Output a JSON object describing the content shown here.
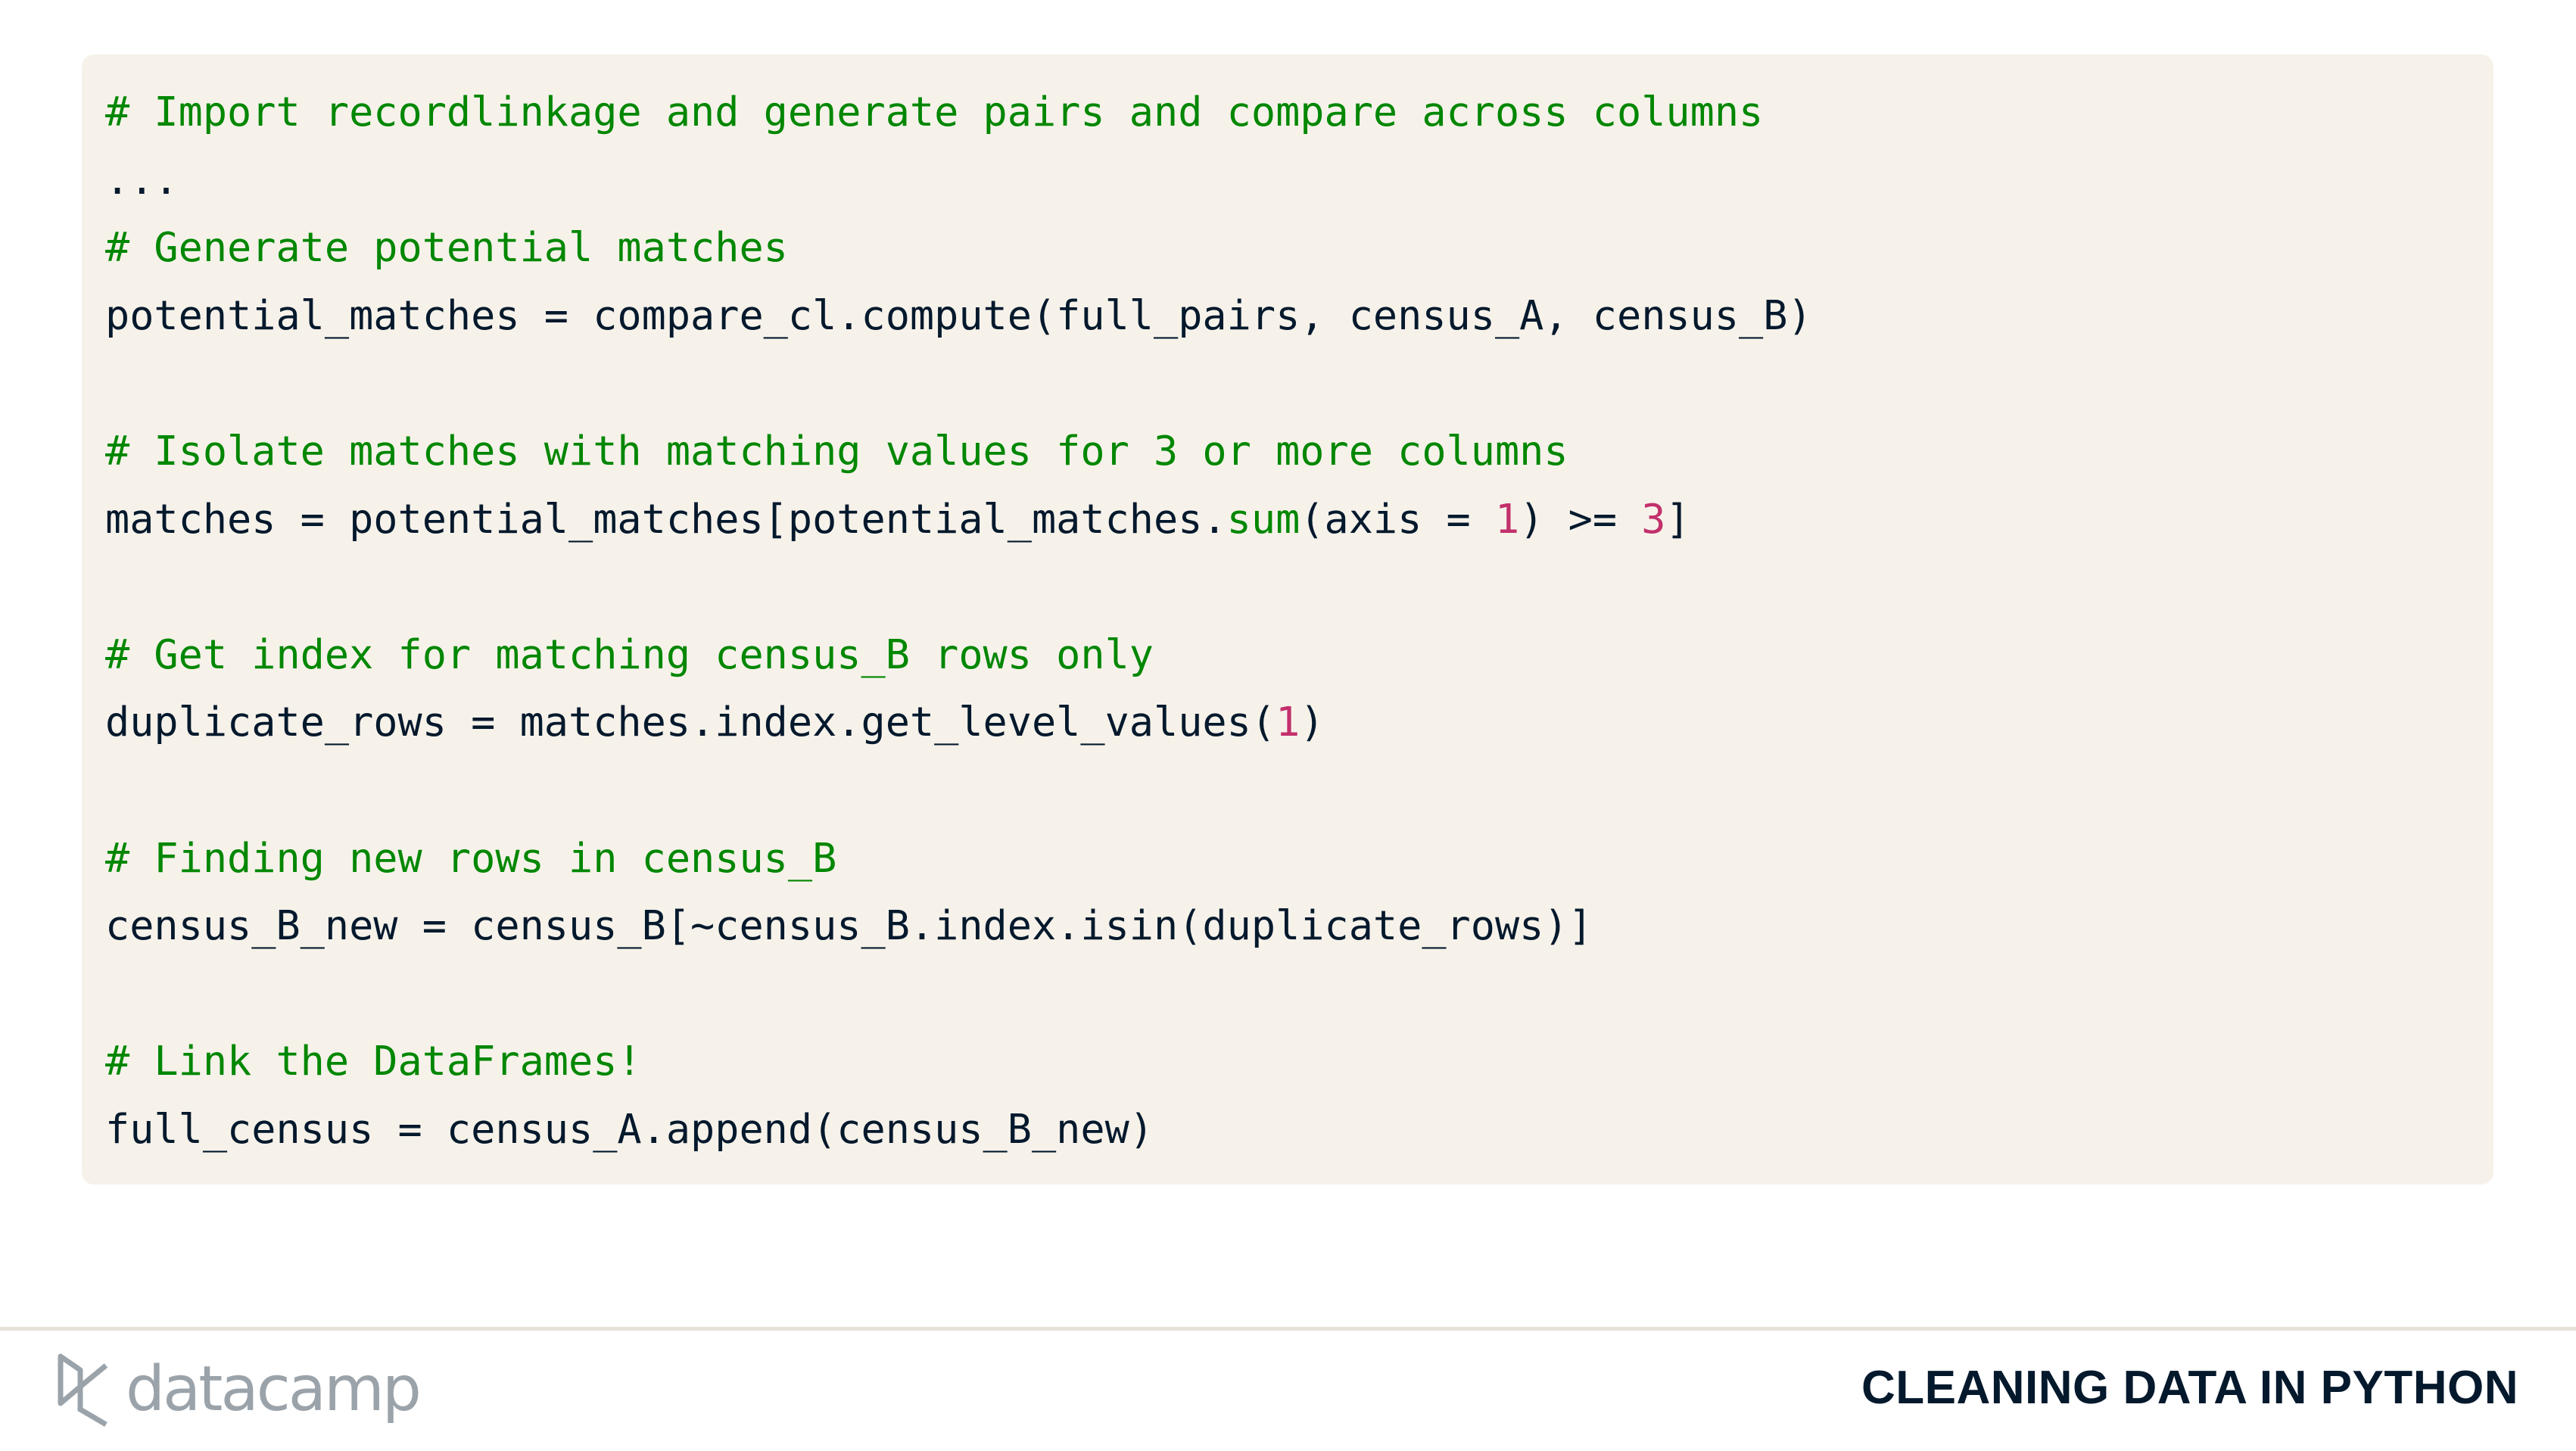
{
  "code": {
    "lines": [
      [
        {
          "t": "comment",
          "v": "# Import recordlinkage and generate pairs and compare across columns"
        }
      ],
      [
        {
          "t": "plain",
          "v": "..."
        }
      ],
      [
        {
          "t": "comment",
          "v": "# Generate potential matches"
        }
      ],
      [
        {
          "t": "plain",
          "v": "potential_matches = compare_cl.compute(full_pairs, census_A, census_B)"
        }
      ],
      [],
      [
        {
          "t": "comment",
          "v": "# Isolate matches with matching values for 3 or more columns"
        }
      ],
      [
        {
          "t": "plain",
          "v": "matches = potential_matches[potential_matches."
        },
        {
          "t": "func",
          "v": "sum"
        },
        {
          "t": "plain",
          "v": "(axis = "
        },
        {
          "t": "num",
          "v": "1"
        },
        {
          "t": "plain",
          "v": ") >= "
        },
        {
          "t": "num",
          "v": "3"
        },
        {
          "t": "plain",
          "v": "]"
        }
      ],
      [],
      [
        {
          "t": "comment",
          "v": "# Get index for matching census_B rows only"
        }
      ],
      [
        {
          "t": "plain",
          "v": "duplicate_rows = matches.index.get_level_values("
        },
        {
          "t": "num",
          "v": "1"
        },
        {
          "t": "plain",
          "v": ")"
        }
      ],
      [],
      [
        {
          "t": "comment",
          "v": "# Finding new rows in census_B"
        }
      ],
      [
        {
          "t": "plain",
          "v": "census_B_new = census_B[~census_B.index.isin(duplicate_rows)]"
        }
      ],
      [],
      [
        {
          "t": "comment",
          "v": "# Link the DataFrames!"
        }
      ],
      [
        {
          "t": "plain",
          "v": "full_census = census_A.append(census_B_new)"
        }
      ]
    ]
  },
  "footer": {
    "logo_text": "datacamp",
    "course_title": "CLEANING DATA IN PYTHON"
  },
  "colors": {
    "comment": "#008700",
    "number": "#C2306C",
    "text": "#05192D",
    "code_bg": "#F6F2EA"
  }
}
